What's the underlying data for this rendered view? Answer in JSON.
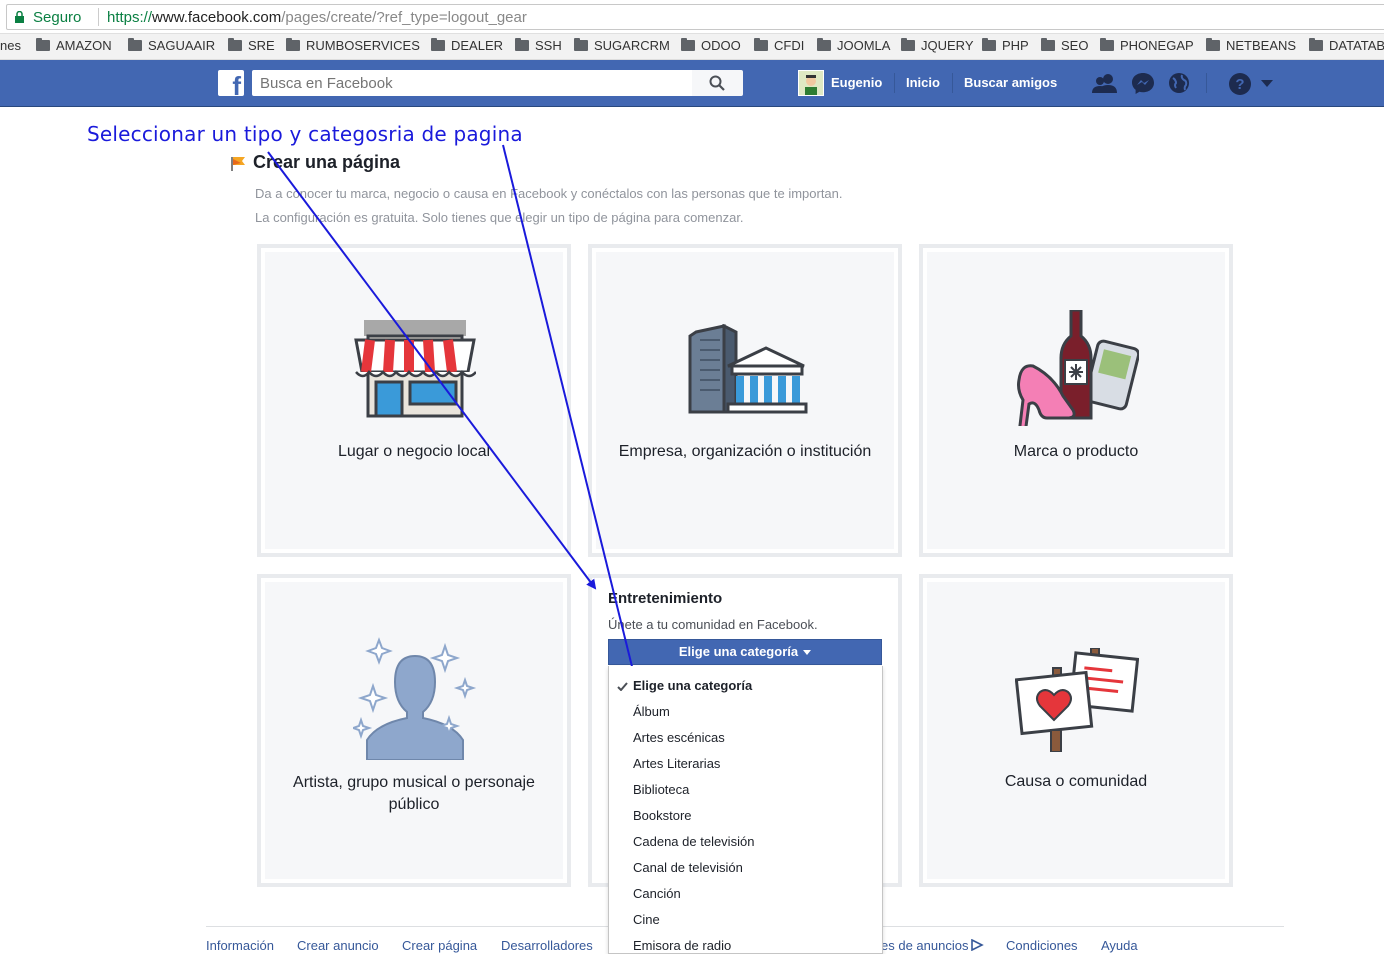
{
  "browser": {
    "secure_label": "Seguro",
    "url_scheme": "https://",
    "url_host": "www.facebook.com",
    "url_path": "/pages/create/?ref_type=logout_gear"
  },
  "bookmarks": [
    "nes",
    "AMAZON",
    "SAGUAAIR",
    "SRE",
    "RUMBOSERVICES",
    "DEALER",
    "SSH",
    "SUGARCRM",
    "ODOO",
    "CFDI",
    "JOOMLA",
    "JQUERY",
    "PHP",
    "SEO",
    "PHONEGAP",
    "NETBEANS",
    "DATATAB"
  ],
  "fb": {
    "logo": "f",
    "search_placeholder": "Busca en Facebook",
    "user_name": "Eugenio",
    "home": "Inicio",
    "find_friends": "Buscar amigos"
  },
  "annotation": "Seleccionar un tipo y categosria de pagina",
  "page": {
    "title": "Crear una página",
    "desc1": "Da a conocer tu marca, negocio o causa en Facebook y conéctalos con las personas que te importan.",
    "desc2": "La configuración es gratuita. Solo tienes que elegir un tipo de página para comenzar."
  },
  "cards": {
    "local": "Lugar o negocio local",
    "company": "Empresa, organización o institución",
    "brand": "Marca o producto",
    "artist_line1": "Artista, grupo musical o personaje",
    "artist_line2": "público",
    "cause": "Causa o comunidad"
  },
  "entertainment": {
    "title": "Entretenimiento",
    "subtitle": "Únete a tu comunidad en Facebook.",
    "button": "Elige una categoría",
    "options": [
      "Elige una categoría",
      "Álbum",
      "Artes escénicas",
      "Artes Literarias",
      "Biblioteca",
      "Bookstore",
      "Cadena de televisión",
      "Canal de televisión",
      "Canción",
      "Cine",
      "Emisora de radio"
    ]
  },
  "footer": {
    "info": "Información",
    "create_ad": "Crear anuncio",
    "create_page": "Crear página",
    "developers": "Desarrolladores",
    "ad_choices": "es de anuncios",
    "terms": "Condiciones",
    "help": "Ayuda"
  },
  "colors": {
    "fb_blue": "#4267b2",
    "annotation": "#1a1adb",
    "link": "#365899"
  }
}
